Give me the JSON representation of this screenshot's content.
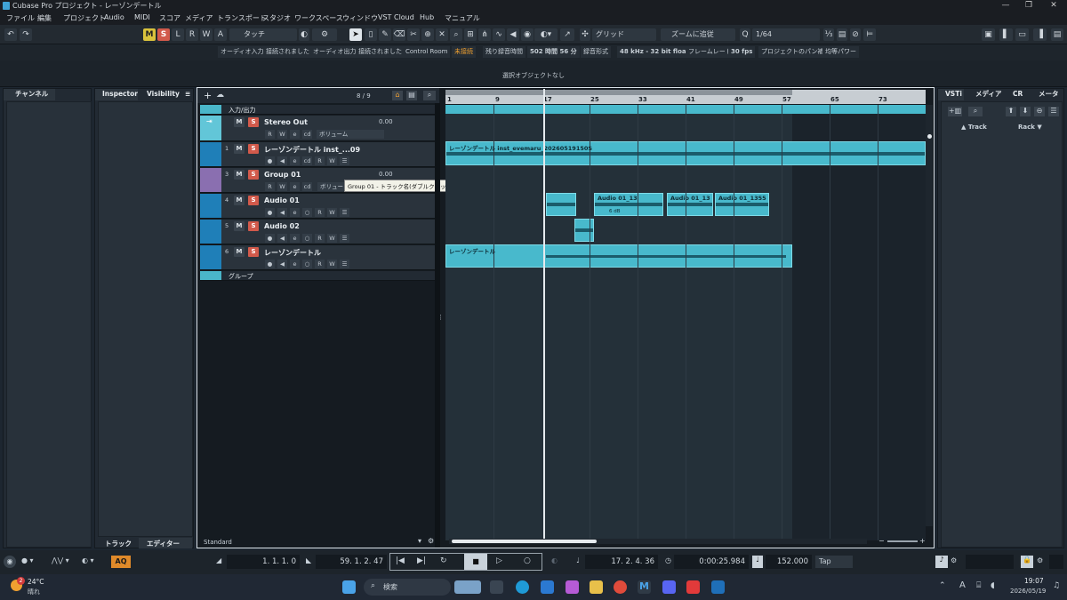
{
  "window": {
    "title": "Cubase Pro プロジェクト - レーゾンデートル",
    "min": "—",
    "max": "❐",
    "close": "✕"
  },
  "menu": [
    "ファイル",
    "編集",
    "プロジェクト",
    "Audio",
    "MIDI",
    "スコア",
    "メディア",
    "トランスポート",
    "スタジオ",
    "ワークスペース",
    "ウィンドウ",
    "VST Cloud",
    "Hub",
    "マニュアル"
  ],
  "toolbar": {
    "m": "M",
    "s": "S",
    "l": "L",
    "r": "R",
    "w": "W",
    "a": "A",
    "automation_mode": "タッチ",
    "snap_type": "グリッド",
    "zoom_mode": "ズームに追従",
    "quantize": "1/64"
  },
  "status": {
    "audio_in_label": "オーディオ入力",
    "audio_in_value": "接続されました",
    "audio_out_label": "オーディオ出力",
    "audio_out_value": "接続されました",
    "control_room_label": "Control Room",
    "control_room_value": "未接続",
    "rec_time_label": "残り録音時間",
    "rec_time_value": "502 時間 56 分",
    "rec_format_label": "録音形式",
    "rec_format_value": "48 kHz - 32 bit float",
    "frame_rate_label": "フレームレート",
    "frame_rate_value": "30 fps",
    "pan_label": "プロジェクトのパン補正",
    "pan_value": "均等パワー"
  },
  "info_line": "選択オブジェクトなし",
  "left_zone": {
    "channel_tab": "チャンネル",
    "inspector_tab": "Inspector",
    "visibility_tab": "Visibility",
    "track_tab": "トラック",
    "editor_tab": "エディター"
  },
  "track_list": {
    "counter": "8 / 9",
    "folder_name": "入力/出力",
    "group_folder_name": "グループ",
    "footer": "Standard",
    "volume_label": "ボリューム",
    "tooltip": "Group 01 - トラック名(ダブルクリック - 編集)"
  },
  "tracks": [
    {
      "num": "",
      "name": "Stereo Out",
      "value": "0.00",
      "color": "#62c6d8"
    },
    {
      "num": "1",
      "name": "レーゾンデートル inst_...09",
      "value": "",
      "color": "#1f7fb8"
    },
    {
      "num": "3",
      "name": "Group 01",
      "value": "0.00",
      "color": "#8a6fb0"
    },
    {
      "num": "4",
      "name": "Audio 01",
      "value": "",
      "color": "#1f7fb8"
    },
    {
      "num": "5",
      "name": "Audio 02",
      "value": "",
      "color": "#1f7fb8"
    },
    {
      "num": "6",
      "name": "レーゾンデートル",
      "value": "",
      "color": "#1f7fb8"
    }
  ],
  "ruler": [
    "1",
    "9",
    "17",
    "25",
    "33",
    "41",
    "49",
    "57",
    "65",
    "73"
  ],
  "events": {
    "inst": "レーゾンデートル inst_evemaru_20260519150S",
    "audio1a": "Audio 01_13",
    "audio1b": "Audio 01_13",
    "audio1c": "Audio 01_1355",
    "vocal": "レーゾンデートル",
    "db": "6 dB"
  },
  "right_zone": {
    "vsti": "VSTi",
    "media": "メディア",
    "cr": "CR",
    "meter": "メーター",
    "track": "Track",
    "rack": "Rack"
  },
  "transport": {
    "left_locator": "1. 1. 1.  0",
    "right_locator": "59. 1. 2. 47",
    "position": "17. 2. 4. 36",
    "time": "0:00:25.984",
    "tempo": "152.000",
    "tap": "Tap",
    "aq": "AQ"
  },
  "taskbar": {
    "temp": "24°C",
    "weather": "晴れ",
    "search": "検索",
    "time": "19:07",
    "date": "2026/05/19",
    "lang": "A",
    "badge": "2"
  }
}
